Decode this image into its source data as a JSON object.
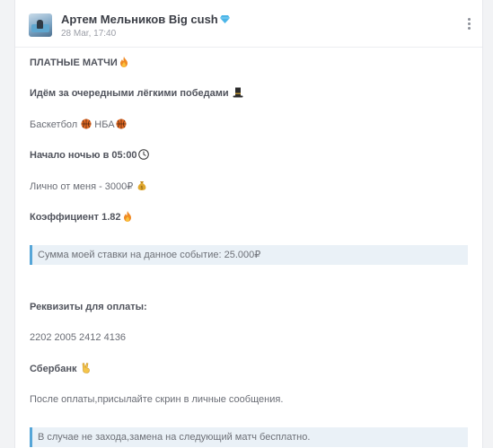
{
  "post": {
    "author": "Артем Мельников Big cush",
    "timestamp": "28 Mar, 17:40"
  },
  "lines": {
    "l1": "ПЛАТНЫЕ МАТЧИ",
    "l2": "Идём за очередными лёгкими победами",
    "l3a": "Баскетбол",
    "l3b": "НБА",
    "l4": "Начало ночью в 05:00",
    "l5": "Лично от меня - 3000₽",
    "l6": "Коэффициент 1.82",
    "q1": "Сумма моей ставки на данное событие: 25.000₽",
    "l7": "Реквизиты для оплаты:",
    "l8": "2202 2005 2412 4136",
    "l9": "Сбербанк",
    "l10": "После оплаты,присылайте скрин в личные сообщения.",
    "q2": "В случае не захода,замена на следующий матч бесплатно."
  },
  "icons": {
    "verified": "diamond-icon",
    "fire": "fire-icon",
    "hat": "top-hat-icon",
    "ball": "basketball-icon",
    "clock": "clock-icon",
    "money": "money-bag-icon",
    "peace": "victory-hand-icon",
    "menu": "more-vertical-icon"
  },
  "colors": {
    "accent": "#56a6d8",
    "quote_bg": "#eaf1f7"
  }
}
